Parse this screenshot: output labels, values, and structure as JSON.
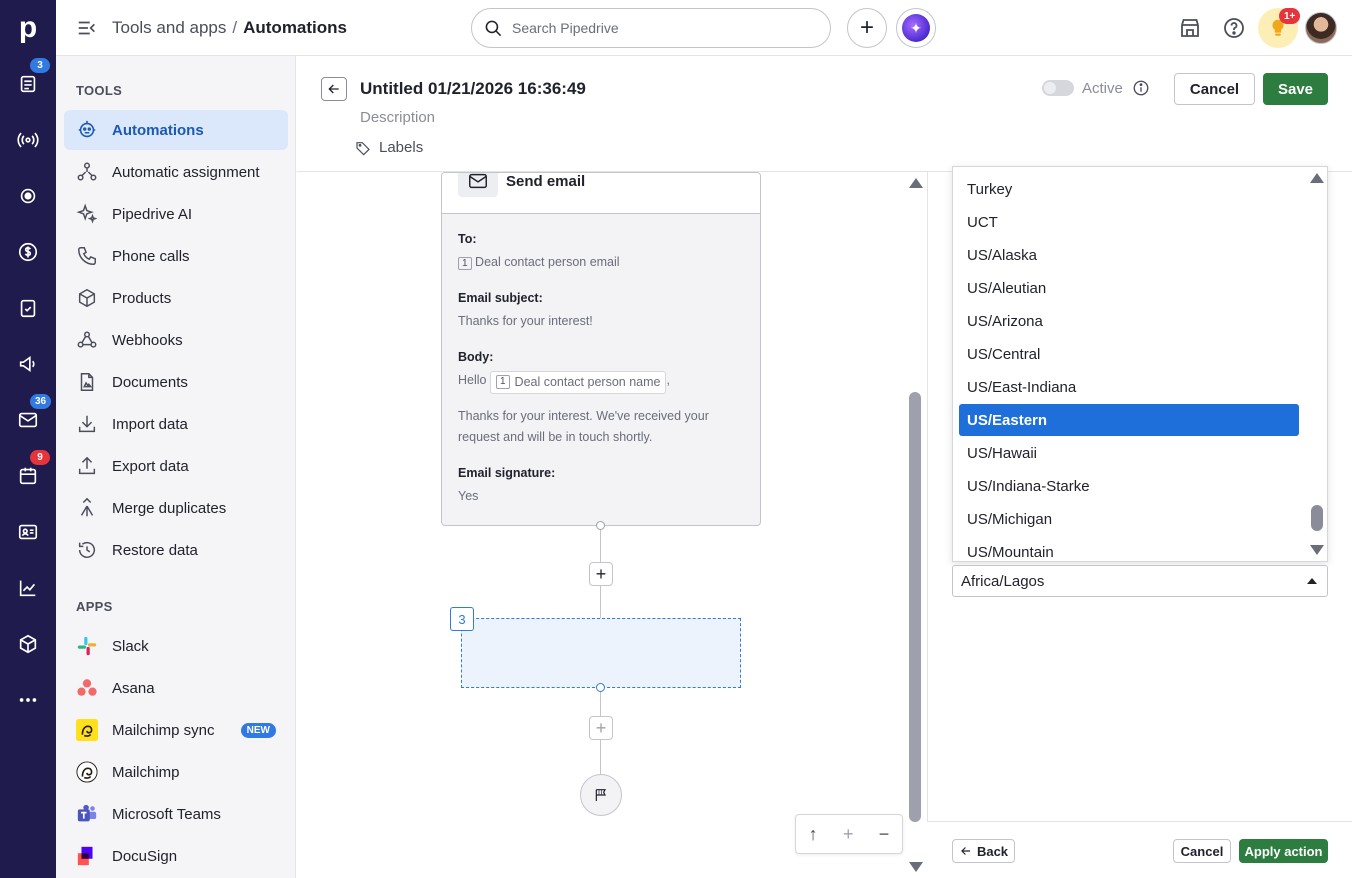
{
  "topbar": {
    "breadcrumb_parent": "Tools and apps",
    "breadcrumb_sep": "/",
    "breadcrumb_current": "Automations",
    "search_placeholder": "Search Pipedrive",
    "notifications_badge": "1+"
  },
  "rail": {
    "logo": "p",
    "badges": {
      "leads": "3",
      "mail": "36",
      "activities": "9"
    }
  },
  "sidebar": {
    "tools_heading": "TOOLS",
    "tools": [
      {
        "label": "Automations",
        "icon": "robot-icon"
      },
      {
        "label": "Automatic assignment",
        "icon": "assignment-icon"
      },
      {
        "label": "Pipedrive AI",
        "icon": "sparkle-icon"
      },
      {
        "label": "Phone calls",
        "icon": "phone-icon"
      },
      {
        "label": "Products",
        "icon": "box-icon"
      },
      {
        "label": "Webhooks",
        "icon": "webhook-icon"
      },
      {
        "label": "Documents",
        "icon": "document-icon"
      },
      {
        "label": "Import data",
        "icon": "import-icon"
      },
      {
        "label": "Export data",
        "icon": "export-icon"
      },
      {
        "label": "Merge duplicates",
        "icon": "merge-icon"
      },
      {
        "label": "Restore data",
        "icon": "restore-icon"
      }
    ],
    "apps_heading": "APPS",
    "apps": [
      {
        "label": "Slack",
        "icon": "slack-icon"
      },
      {
        "label": "Asana",
        "icon": "asana-icon"
      },
      {
        "label": "Mailchimp sync",
        "icon": "mailchimp-icon",
        "badge": "NEW"
      },
      {
        "label": "Mailchimp",
        "icon": "mailchimp-icon"
      },
      {
        "label": "Microsoft Teams",
        "icon": "teams-icon"
      },
      {
        "label": "DocuSign",
        "icon": "docusign-icon"
      }
    ]
  },
  "header": {
    "title": "Untitled 01/21/2026 16:36:49",
    "description": "Description",
    "labels": "Labels",
    "active_label": "Active",
    "cancel": "Cancel",
    "save": "Save"
  },
  "card": {
    "title": "Send email",
    "to_label": "To:",
    "to_num": "1",
    "to_value": "Deal contact person email",
    "subject_label": "Email subject:",
    "subject_value": "Thanks for your interest!",
    "body_label": "Body:",
    "body_hello": "Hello",
    "body_num": "1",
    "body_chip": "Deal contact person name",
    "body_comma": ",",
    "body_text": "Thanks for your interest. We've received your request and will be in touch shortly.",
    "signature_label": "Email signature:",
    "signature_value": "Yes"
  },
  "canvas": {
    "step_number": "3"
  },
  "timezone": {
    "options": [
      "Turkey",
      "UCT",
      "US/Alaska",
      "US/Aleutian",
      "US/Arizona",
      "US/Central",
      "US/East-Indiana",
      "US/Eastern",
      "US/Hawaii",
      "US/Indiana-Starke",
      "US/Michigan",
      "US/Mountain"
    ],
    "highlighted": "US/Eastern",
    "selected_value": "Africa/Lagos"
  },
  "footer": {
    "back": "Back",
    "cancel": "Cancel",
    "apply": "Apply action"
  },
  "colors": {
    "rail_bg": "#1f1b4d",
    "accent_blue": "#317ae2",
    "save_green": "#2c7d3f",
    "highlight": "#1e6fd9"
  }
}
